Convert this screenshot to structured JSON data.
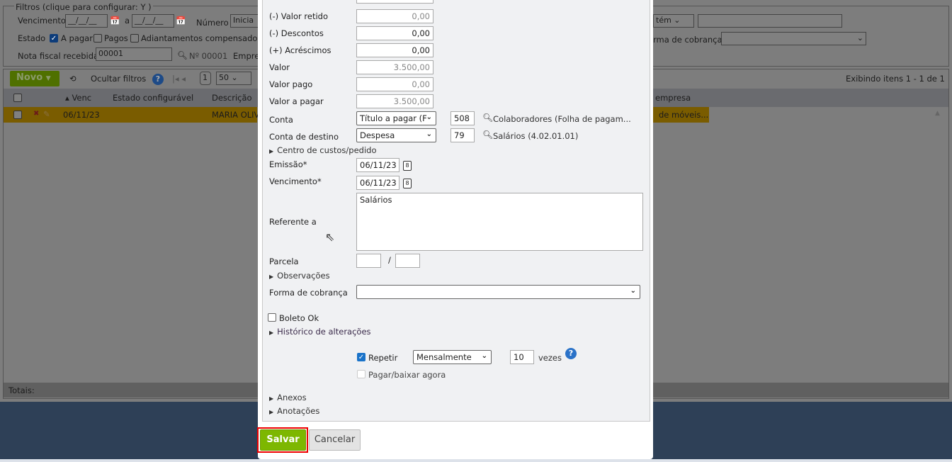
{
  "background": {
    "filters": {
      "legend": "Filtros (clique para configurar:",
      "vencimento_label": "Vencimento",
      "vencimento_from": "__/__/__",
      "a_label": "a",
      "vencimento_to": "__/__/__",
      "numero_label": "Número",
      "numero_mode": "Inicia",
      "contem_mode": "tém",
      "estado_label": "Estado",
      "estado_a_pagar": "A pagar",
      "estado_pagos": "Pagos",
      "estado_adiantamentos": "Adiantamentos compensados",
      "forma_cobranca_label": "rma de cobrança",
      "nota_fiscal_label": "Nota fiscal recebida",
      "nota_fiscal_value": "00001",
      "nota_fiscal_number": "Nº 00001",
      "empresa_label": "Empre"
    },
    "toolbar": {
      "novo": "Novo",
      "ocultar_filtros": "Ocultar filtros",
      "page": "1",
      "page_size": "50",
      "summary": "Exibindo itens 1 - 1 de 1"
    },
    "grid": {
      "columns": [
        "Venc",
        "Estado configurável",
        "Descrição",
        "empresa"
      ],
      "rows": [
        {
          "venc": "06/11/23",
          "estado": "",
          "descricao": "MARIA OLIV",
          "empresa": "de móveis..."
        }
      ],
      "totals_label": "Totais:"
    }
  },
  "form": {
    "valor_retido_label": "(-) Valor retido",
    "valor_retido": "0,00",
    "descontos_label": "(-) Descontos",
    "descontos": "0,00",
    "acrescimos_label": "(+) Acréscimos",
    "acrescimos": "0,00",
    "valor_label": "Valor",
    "valor": "3.500,00",
    "valor_pago_label": "Valor pago",
    "valor_pago": "0,00",
    "valor_a_pagar_label": "Valor a pagar",
    "valor_a_pagar": "3.500,00",
    "conta_label": "Conta",
    "conta_tipo": "Título a pagar (F",
    "conta_codigo": "508",
    "conta_nome": "Colaboradores (Folha de pagam...",
    "conta_destino_label": "Conta de destino",
    "conta_destino_tipo": "Despesa",
    "conta_destino_codigo": "79",
    "conta_destino_nome": "Salários (4.02.01.01)",
    "centro_custos": "Centro de custos/pedido",
    "emissao_label": "Emissão*",
    "emissao": "06/11/23",
    "vencimento_label": "Vencimento*",
    "vencimento": "06/11/23",
    "referente_label": "Referente a",
    "referente": "Salários",
    "parcela_label": "Parcela",
    "parcela_sep": "/",
    "parcela_num": "",
    "parcela_total": "",
    "observacoes": "Observações",
    "forma_cobranca_label": "Forma de cobrança",
    "forma_cobranca": "",
    "boleto_ok": "Boleto Ok",
    "historico": "Histórico de alterações",
    "repetir_label": "Repetir",
    "repetir_frequencia": "Mensalmente",
    "repetir_vezes": "10",
    "vezes_label": "vezes",
    "pagar_agora": "Pagar/baixar agora",
    "anexos": "Anexos",
    "anotacoes": "Anotações",
    "salvar": "Salvar",
    "cancelar": "Cancelar"
  },
  "colors": {
    "accent_green": "#7db700",
    "highlight_row": "#7a5c00",
    "overlay_bg": "#2e4057",
    "highlight_frame": "#e00000"
  }
}
